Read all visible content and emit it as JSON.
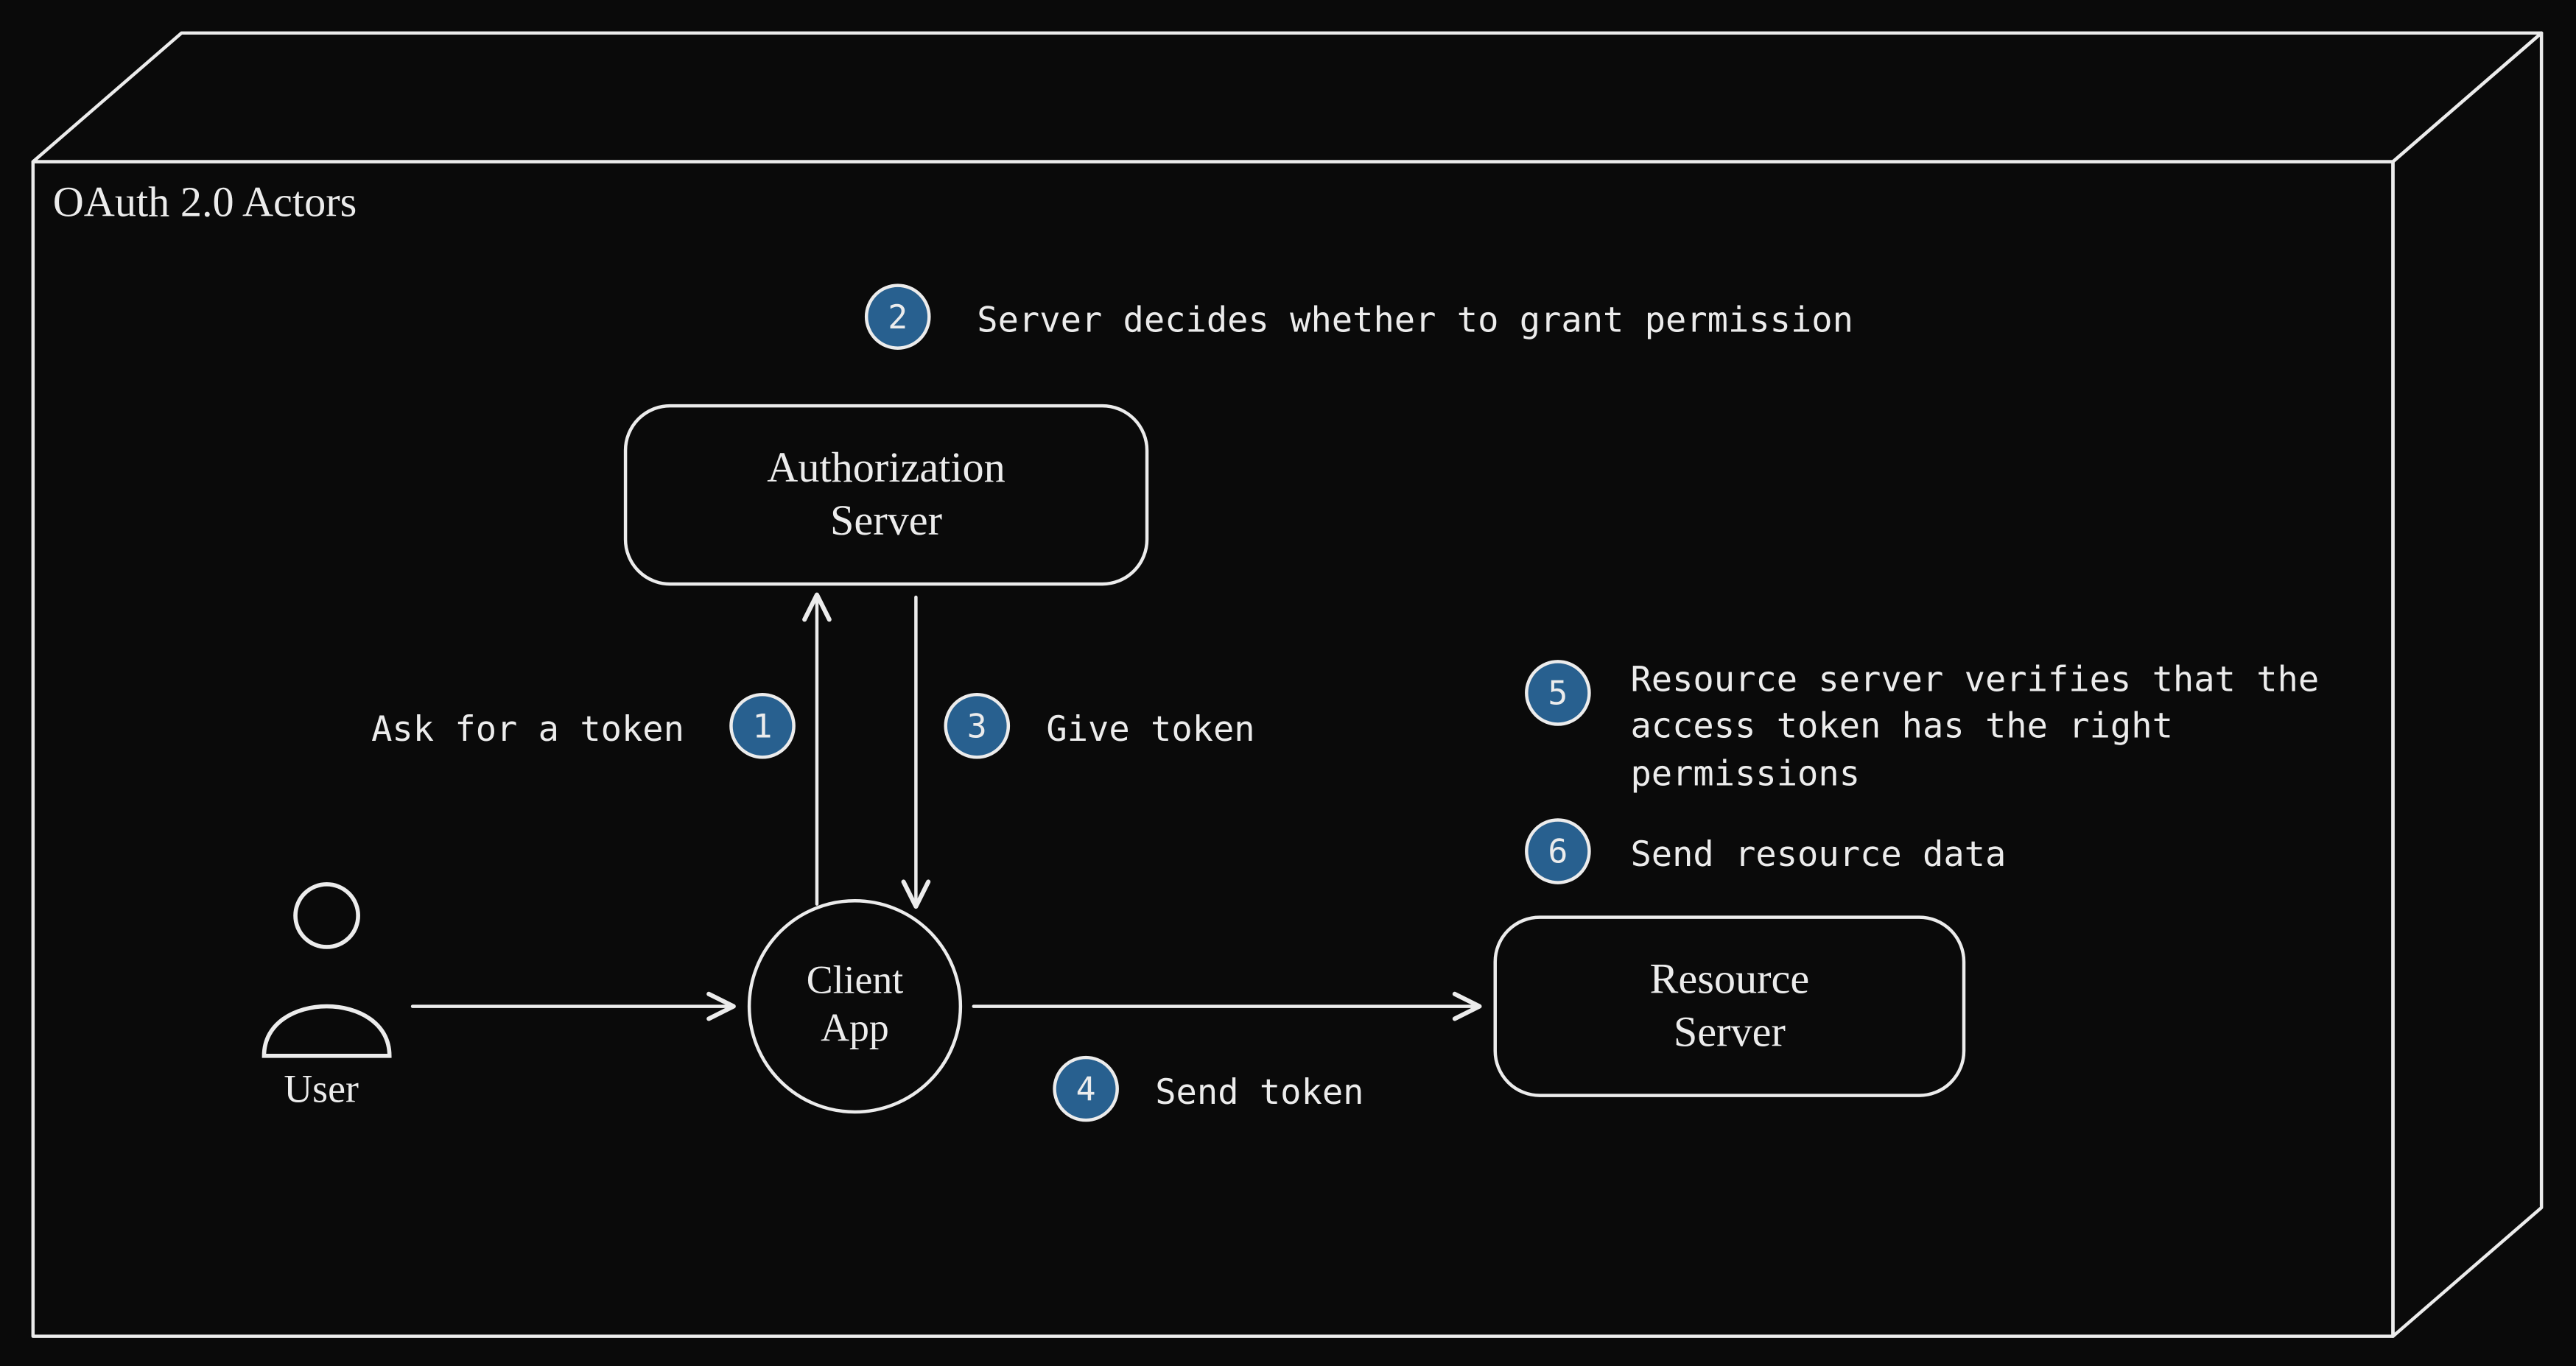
{
  "title": "OAuth 2.0 Actors",
  "nodes": {
    "user": "User",
    "client_l1": "Client",
    "client_l2": "App",
    "auth_l1": "Authorization",
    "auth_l2": "Server",
    "resource_l1": "Resource",
    "resource_l2": "Server"
  },
  "steps": {
    "1": {
      "num": "1",
      "text": "Ask for a token"
    },
    "2": {
      "num": "2",
      "text": "Server decides whether to grant permission"
    },
    "3": {
      "num": "3",
      "text": "Give token"
    },
    "4": {
      "num": "4",
      "text": "Send token"
    },
    "5": {
      "num": "5",
      "text": "Resource server verifies that the access token has the right permissions"
    },
    "6": {
      "num": "6",
      "text": "Send resource data"
    }
  },
  "colors": {
    "bg": "#0a0a0a",
    "stroke": "#ececec",
    "badge": "#28608f"
  }
}
